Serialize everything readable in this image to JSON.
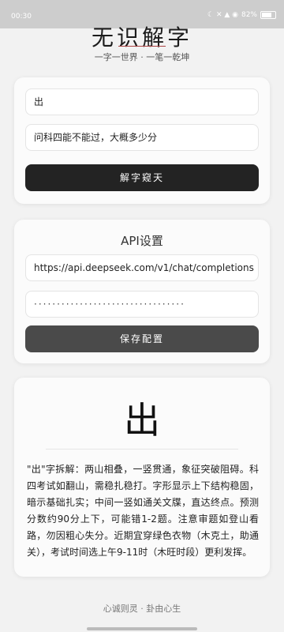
{
  "status_bar": {
    "time": "00:30",
    "icons": "☾ ✕ ▲ ◉",
    "battery": "82%"
  },
  "header": {
    "title": "无识解字",
    "subtitle": "一字一世界 · 一笔一乾坤"
  },
  "input_card": {
    "char_value": "出",
    "question_value": "问科四能不能过，大概多少分",
    "submit_label": "解字窥天"
  },
  "api_card": {
    "title": "API设置",
    "url_value": "https://api.deepseek.com/v1/chat/completions",
    "key_masked": "·································",
    "save_label": "保存配置"
  },
  "result_card": {
    "char": "出",
    "text": "\"出\"字拆解：两山相叠，一竖贯通，象征突破阻碍。科四考试如翻山，需稳扎稳打。字形显示上下结构稳固，暗示基础扎实；中间一竖如通关文牒，直达终点。预测分数约90分上下，可能错1-2题。注意审题如登山看路，勿因粗心失分。近期宜穿绿色衣物（木克土，助通关），考试时间选上午9-11时（木旺时段）更利发挥。"
  },
  "footer": {
    "text": "心诚则灵 · 卦由心生"
  }
}
